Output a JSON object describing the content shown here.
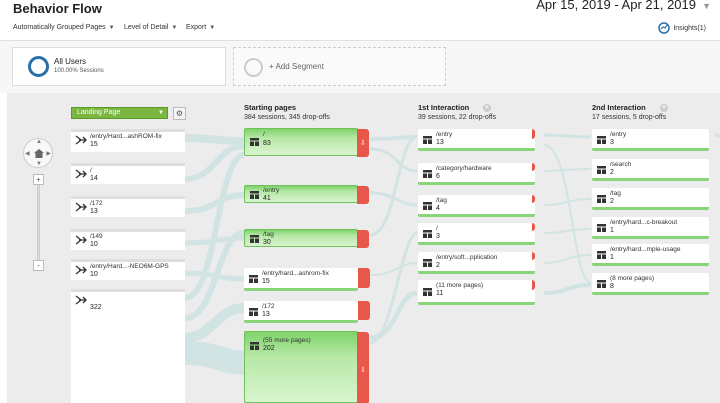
{
  "header": {
    "title": "Behavior Flow",
    "date_range": "Apr 15, 2019 - Apr 21, 2019"
  },
  "toolbar": {
    "grouping": "Automatically Grouped Pages",
    "detail": "Level of Detail",
    "export": "Export",
    "insights": "Insights(1)"
  },
  "segments": {
    "active": {
      "name": "All Users",
      "sub": "100.00% Sessions"
    },
    "add": "+ Add Segment"
  },
  "dimension": {
    "selected": "Landing Page"
  },
  "columns": [
    {
      "title": "Starting pages",
      "sub": "384 sessions, 345 drop-offs"
    },
    {
      "title": "1st Interaction",
      "sub": "39 sessions, 22 drop-offs"
    },
    {
      "title": "2nd Interaction",
      "sub": "17 sessions, 5 drop-offs"
    }
  ],
  "sources": [
    {
      "name": "/entry/Hard...ashROM-fix",
      "count": "15"
    },
    {
      "name": "/",
      "count": "14"
    },
    {
      "name": "/172",
      "count": "13"
    },
    {
      "name": "/149",
      "count": "10"
    },
    {
      "name": "/entry/Hard...-NEO6M-GPS",
      "count": "10"
    },
    {
      "name": "",
      "count": "322"
    }
  ],
  "starting_pages": [
    {
      "name": "/",
      "count": "83"
    },
    {
      "name": "/entry",
      "count": "41"
    },
    {
      "name": "/tag",
      "count": "30"
    },
    {
      "name": "/entry/hard...ashrom-fix",
      "count": "15"
    },
    {
      "name": "/172",
      "count": "13"
    },
    {
      "name": "(55 more pages)",
      "count": "202"
    }
  ],
  "first_interaction": [
    {
      "name": "/entry",
      "count": "13"
    },
    {
      "name": "/category/hardware",
      "count": "6"
    },
    {
      "name": "/tag",
      "count": "4"
    },
    {
      "name": "/",
      "count": "3"
    },
    {
      "name": "/entry/soft...pplication",
      "count": "2"
    },
    {
      "name": "(11 more pages)",
      "count": "11"
    }
  ],
  "second_interaction": [
    {
      "name": "/entry",
      "count": "3"
    },
    {
      "name": "/search",
      "count": "2"
    },
    {
      "name": "/tag",
      "count": "2"
    },
    {
      "name": "/entry/hard...c-breakout",
      "count": "1"
    },
    {
      "name": "/entry/hard...mple-usage",
      "count": "1"
    },
    {
      "name": "(8 more pages)",
      "count": "8"
    }
  ],
  "zoom": {
    "plus": "+",
    "minus": "-"
  },
  "colors": {
    "node_green": "#7fd36b",
    "dropoff_red": "#e8584a",
    "flow_link": "#cfe3e3",
    "segment_ring": "#2a6fa8",
    "dimension_green": "#7ab640"
  }
}
